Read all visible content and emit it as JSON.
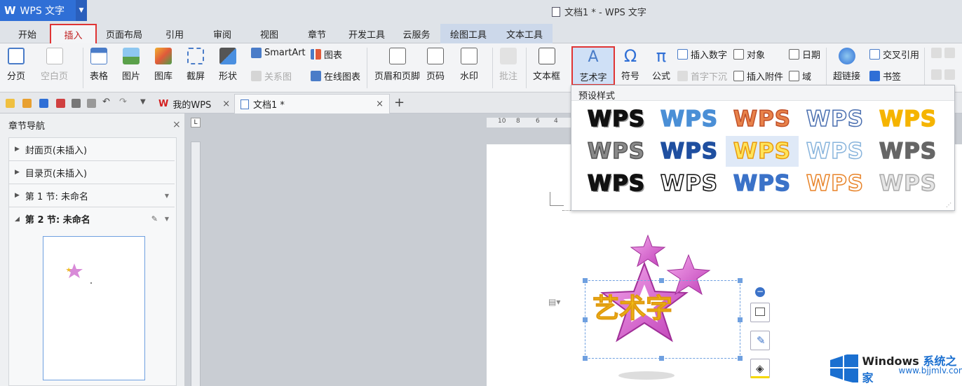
{
  "app": {
    "logo": "W",
    "name": "WPS 文字",
    "window_title": "文档1 * - WPS 文字"
  },
  "tabs": [
    {
      "label": "开始"
    },
    {
      "label": "插入"
    },
    {
      "label": "页面布局"
    },
    {
      "label": "引用"
    },
    {
      "label": "审阅"
    },
    {
      "label": "视图"
    },
    {
      "label": "章节"
    },
    {
      "label": "开发工具"
    },
    {
      "label": "云服务"
    },
    {
      "label": "绘图工具"
    },
    {
      "label": "文本工具"
    }
  ],
  "ribbon": {
    "page_break": "分页",
    "blank_page": "空白页",
    "table": "表格",
    "picture": "图片",
    "gallery": "图库",
    "screenshot": "截屏",
    "shape": "形状",
    "smartart": "SmartArt",
    "relation": "关系图",
    "chart": "图表",
    "online_chart": "在线图表",
    "header_footer": "页眉和页脚",
    "page_number": "页码",
    "watermark": "水印",
    "comment": "批注",
    "textbox": "文本框",
    "wordart": "艺术字",
    "symbol": "符号",
    "formula": "公式",
    "insert_number": "插入数字",
    "drop_cap": "首字下沉",
    "object": "对象",
    "attachment": "插入附件",
    "date": "日期",
    "field": "域",
    "hyperlink": "超链接",
    "cross_ref": "交叉引用",
    "bookmark": "书签"
  },
  "doctabs": [
    {
      "label": "我的WPS"
    },
    {
      "label": "文档1 *"
    }
  ],
  "nav": {
    "title": "章节导航",
    "items": [
      {
        "label": "封面页(未插入)"
      },
      {
        "label": "目录页(未插入)"
      },
      {
        "label": "第 1 节: 未命名"
      },
      {
        "label": "第 2 节: 未命名"
      }
    ]
  },
  "ruler_numbers": [
    "10",
    "8",
    "6",
    "4"
  ],
  "gallery": {
    "title": "预设样式",
    "sample_text": "WPS",
    "styles": [
      {
        "color": "#111111",
        "outline": "#111111"
      },
      {
        "color": "#4a8fd6",
        "outline": "#4a8fd6"
      },
      {
        "color": "#e8824a",
        "outline": "#c0502a"
      },
      {
        "color": "#ffffff",
        "outline": "#4a6fb0"
      },
      {
        "color": "#f5b400",
        "outline": "#f5b400"
      },
      {
        "color": "#8a8a8a",
        "outline": "#555555"
      },
      {
        "color": "#1f4fa0",
        "outline": "#1f4fa0"
      },
      {
        "color": "#ffe45a",
        "outline": "#e89a10"
      },
      {
        "color": "#ffffff",
        "outline": "#88b4dc"
      },
      {
        "color": "#666666",
        "outline": "#666666"
      },
      {
        "color": "#111111",
        "outline": "#111111"
      },
      {
        "color": "#ffffff",
        "outline": "#111111"
      },
      {
        "color": "#3b72c8",
        "outline": "#3b72c8"
      },
      {
        "color": "#ffffff",
        "outline": "#e8842a"
      },
      {
        "color": "#e6e6e6",
        "outline": "#aaaaaa"
      }
    ]
  },
  "wordart_text": "艺术字",
  "watermark": {
    "brand": "Windows",
    "brand_cn": "系统之家",
    "url": "www.bjjmlv.com"
  },
  "colors": {
    "accent": "#2f6fd6",
    "highlight": "#e03434"
  }
}
